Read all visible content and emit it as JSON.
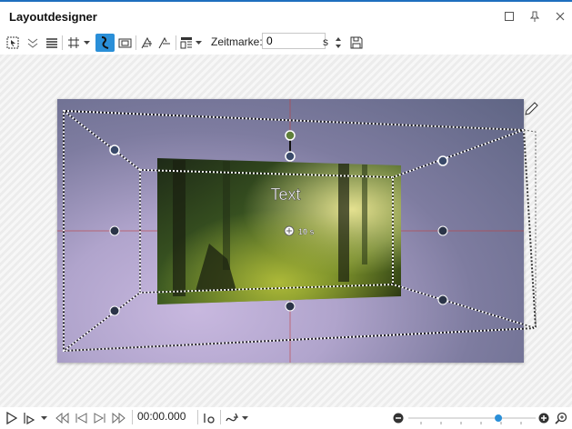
{
  "window": {
    "title": "Layoutdesigner"
  },
  "toolbar": {
    "zeitmarke_label": "Zeitmarke:",
    "zeitmarke_value": "0",
    "unit": "s"
  },
  "canvas": {
    "text_object_label": "Text",
    "duration_badge": "10 s"
  },
  "playback": {
    "timecode": "00:00.000",
    "zoom_level": 0.72
  },
  "colors": {
    "accent": "#2a8fd8",
    "title_border": "#1e6fbe"
  }
}
